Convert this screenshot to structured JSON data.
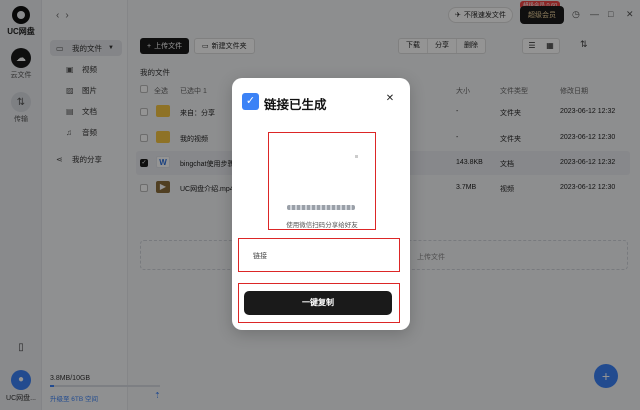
{
  "app": {
    "logo_text": "UC网盘"
  },
  "rail": {
    "items": [
      {
        "label": "云文件",
        "icon": "cloud-icon"
      },
      {
        "label": "传输",
        "icon": "transfer-icon"
      }
    ],
    "user_label": "UC网盘..."
  },
  "sidebar": {
    "my_files": "我的文件",
    "items": [
      {
        "label": "视频",
        "icon": "video-icon"
      },
      {
        "label": "图片",
        "icon": "image-icon"
      },
      {
        "label": "文档",
        "icon": "document-icon"
      },
      {
        "label": "音频",
        "icon": "audio-icon"
      }
    ],
    "my_share": "我的分享",
    "storage": "3.8MB/10GB",
    "upgrade": "升级至 6TB 空间"
  },
  "topbar": {
    "promo": "不限速发文件",
    "vip_tag": "超级会员 0.60",
    "vip": "超级会员"
  },
  "toolbar": {
    "upload": "上传文件",
    "new_folder": "新建文件夹",
    "download": "下载",
    "share": "分享",
    "delete": "删除"
  },
  "main": {
    "breadcrumb": "我的文件",
    "select_all": "全选",
    "selected": "已选中 1",
    "columns": {
      "size": "大小",
      "type": "文件类型",
      "modified": "修改日期"
    },
    "rows": [
      {
        "name": "来自：分享",
        "size": "-",
        "type": "文件夹",
        "date": "2023-06-12 12:32",
        "kind": "folder"
      },
      {
        "name": "我的视频",
        "size": "-",
        "type": "文件夹",
        "date": "2023-06-12 12:30",
        "kind": "folder"
      },
      {
        "name": "bingchat使用步骤",
        "size": "143.8KB",
        "type": "文档",
        "date": "2023-06-12 12:32",
        "kind": "doc"
      },
      {
        "name": "UC网盘介绍.mp4",
        "size": "3.7MB",
        "type": "视频",
        "date": "2023-06-12 12:30",
        "kind": "video"
      }
    ],
    "drop_text": "上传文件"
  },
  "modal": {
    "title": "链接已生成",
    "qr_caption": "使用微信扫码分享给好友",
    "link_value": "链接",
    "copy_label": "一键复制"
  }
}
